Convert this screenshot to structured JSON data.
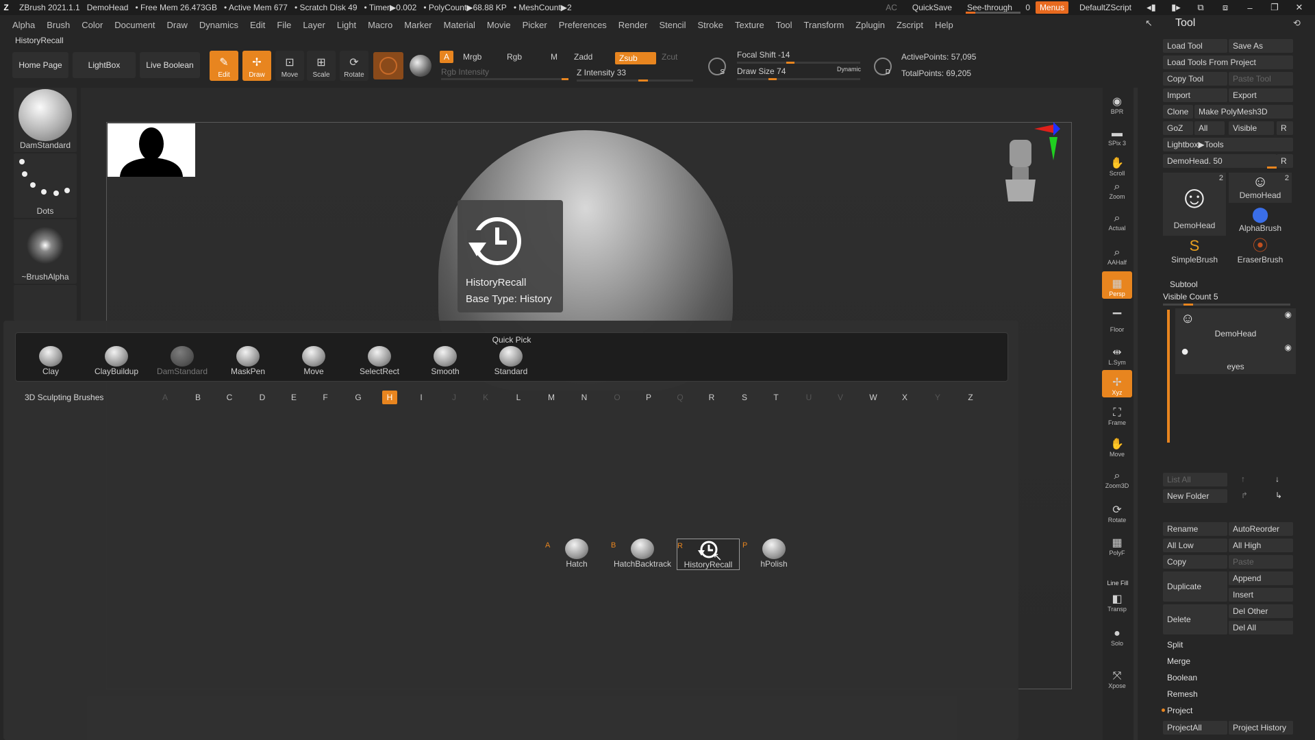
{
  "titlebar": {
    "app": "ZBrush 2021.1.1",
    "document": "DemoHead",
    "free_mem": "• Free Mem 26.473GB",
    "active_mem": "• Active Mem 677",
    "scratch": "• Scratch Disk 49",
    "timer": "• Timer▶0.002",
    "polycount": "• PolyCount▶68.88 KP",
    "meshcount": "• MeshCount▶2",
    "ac": "AC",
    "quicksave": "QuickSave",
    "see_through": "See-through",
    "see_through_value": "0",
    "menus": "Menus",
    "default_script": "DefaultZScript"
  },
  "menubar": [
    "Alpha",
    "Brush",
    "Color",
    "Document",
    "Draw",
    "Dynamics",
    "Edit",
    "File",
    "Layer",
    "Light",
    "Macro",
    "Marker",
    "Material",
    "Movie",
    "Picker",
    "Preferences",
    "Render",
    "Stencil",
    "Stroke",
    "Texture",
    "Tool",
    "Transform",
    "Zplugin",
    "Zscript",
    "Help"
  ],
  "active_tool_label": "HistoryRecall",
  "toolbar": {
    "home_page": "Home Page",
    "lightbox": "LightBox",
    "live_boolean": "Live Boolean",
    "edit": "Edit",
    "draw": "Draw",
    "move": "Move",
    "scale": "Scale",
    "rotate": "Rotate",
    "a_label": "A",
    "mrgb": "Mrgb",
    "rgb": "Rgb",
    "m": "M",
    "rgb_intensity": "Rgb Intensity",
    "zadd": "Zadd",
    "zsub": "Zsub",
    "zcut": "Zcut",
    "z_intensity": "Z Intensity 33",
    "focal_shift": "Focal Shift -14",
    "draw_size": "Draw Size 74",
    "dynamic": "Dynamic",
    "active_points": "ActivePoints: 57,095",
    "total_points": "TotalPoints: 69,205",
    "s_label": "S",
    "d_label": "D"
  },
  "left_column": {
    "brush": "DamStandard",
    "stroke": "Dots",
    "alpha": "~BrushAlpha"
  },
  "tooltip": {
    "title": "HistoryRecall",
    "subtitle": "Base Type: History"
  },
  "quick_pick": {
    "title": "Quick Pick",
    "items": [
      {
        "label": "Clay",
        "dim": false
      },
      {
        "label": "ClayBuildup",
        "dim": false
      },
      {
        "label": "DamStandard",
        "dim": true
      },
      {
        "label": "MaskPen",
        "dim": false
      },
      {
        "label": "Move",
        "dim": false
      },
      {
        "label": "SelectRect",
        "dim": false
      },
      {
        "label": "Smooth",
        "dim": false
      },
      {
        "label": "Standard",
        "dim": false
      }
    ]
  },
  "alpha_filter": {
    "category": "3D Sculpting Brushes",
    "letters": [
      "A",
      "B",
      "C",
      "D",
      "E",
      "F",
      "G",
      "H",
      "I",
      "J",
      "K",
      "L",
      "M",
      "N",
      "O",
      "P",
      "Q",
      "R",
      "S",
      "T",
      "U",
      "V",
      "W",
      "X",
      "Y",
      "Z"
    ],
    "dim_letters": [
      "A",
      "J",
      "K",
      "O",
      "Q",
      "U",
      "V",
      "Y"
    ],
    "selected": "H"
  },
  "brushes": [
    {
      "key": "A",
      "label": "Hatch"
    },
    {
      "key": "B",
      "label": "HatchBacktrack"
    },
    {
      "key": "R",
      "label": "HistoryRecall"
    },
    {
      "key": "P",
      "label": "hPolish"
    }
  ],
  "right_strip": [
    {
      "label": "BPR",
      "icon": "bpr-icon",
      "on": false
    },
    {
      "label": "SPix 3",
      "icon": "spix-icon",
      "on": false
    },
    {
      "label": "Scroll",
      "icon": "scroll-icon",
      "on": false
    },
    {
      "label": "Zoom",
      "icon": "zoom-icon",
      "on": false
    },
    {
      "label": "Actual",
      "icon": "actual-icon",
      "on": false
    },
    {
      "label": "AAHalf",
      "icon": "aahalf-icon",
      "on": false
    },
    {
      "label": "Persp",
      "icon": "persp-icon",
      "on": true
    },
    {
      "label": "Floor",
      "icon": "floor-icon",
      "on": false
    },
    {
      "label": "L.Sym",
      "icon": "lsym-icon",
      "on": false
    },
    {
      "label": "Xyz",
      "icon": "xyz-icon",
      "on": true
    },
    {
      "label": "Frame",
      "icon": "frame-icon",
      "on": false
    },
    {
      "label": "Move",
      "icon": "move-icon",
      "on": false
    },
    {
      "label": "Zoom3D",
      "icon": "zoom3d-icon",
      "on": false
    },
    {
      "label": "Rotate",
      "icon": "rotate-icon",
      "on": false
    },
    {
      "label": "PolyF",
      "icon": "polyf-icon",
      "on": false
    },
    {
      "label": "Transp",
      "icon": "transp-icon",
      "on": false
    },
    {
      "label": "Solo",
      "icon": "solo-icon",
      "on": false
    },
    {
      "label": "Xpose",
      "icon": "xpose-icon",
      "on": false
    }
  ],
  "line_fill": "Line Fill",
  "tool_panel": {
    "title": "Tool",
    "load_tool": "Load Tool",
    "save_as": "Save As",
    "load_tools_from_project": "Load Tools From Project",
    "copy_tool": "Copy Tool",
    "paste_tool": "Paste Tool",
    "import": "Import",
    "export": "Export",
    "clone": "Clone",
    "make_polymesh": "Make PolyMesh3D",
    "goz": "GoZ",
    "all": "All",
    "visible": "Visible",
    "r": "R",
    "lightbox_tools": "Lightbox▶Tools",
    "demohead_slider": "DemoHead. 50",
    "thumbs": [
      {
        "label": "DemoHead",
        "count": "2"
      },
      {
        "label": "DemoHead",
        "count": "2"
      },
      {
        "label": "AlphaBrush",
        "count": ""
      },
      {
        "label": "SimpleBrush",
        "count": ""
      },
      {
        "label": "EraserBrush",
        "count": ""
      }
    ],
    "subtool": "Subtool",
    "visible_count": "Visible Count 5",
    "subtool_1": "DemoHead",
    "subtool_2": "eyes",
    "list_all": "List All",
    "new_folder": "New Folder",
    "rename": "Rename",
    "autoreorder": "AutoReorder",
    "all_low": "All Low",
    "all_high": "All High",
    "copy": "Copy",
    "paste": "Paste",
    "duplicate": "Duplicate",
    "append": "Append",
    "insert": "Insert",
    "delete": "Delete",
    "del_other": "Del Other",
    "del_all": "Del All",
    "split": "Split",
    "merge": "Merge",
    "boolean": "Boolean",
    "remesh": "Remesh",
    "project": "Project",
    "project_all": "ProjectAll",
    "project_history": "Project History"
  },
  "colors": {
    "accent": "#e8851f",
    "background": "#262626"
  }
}
